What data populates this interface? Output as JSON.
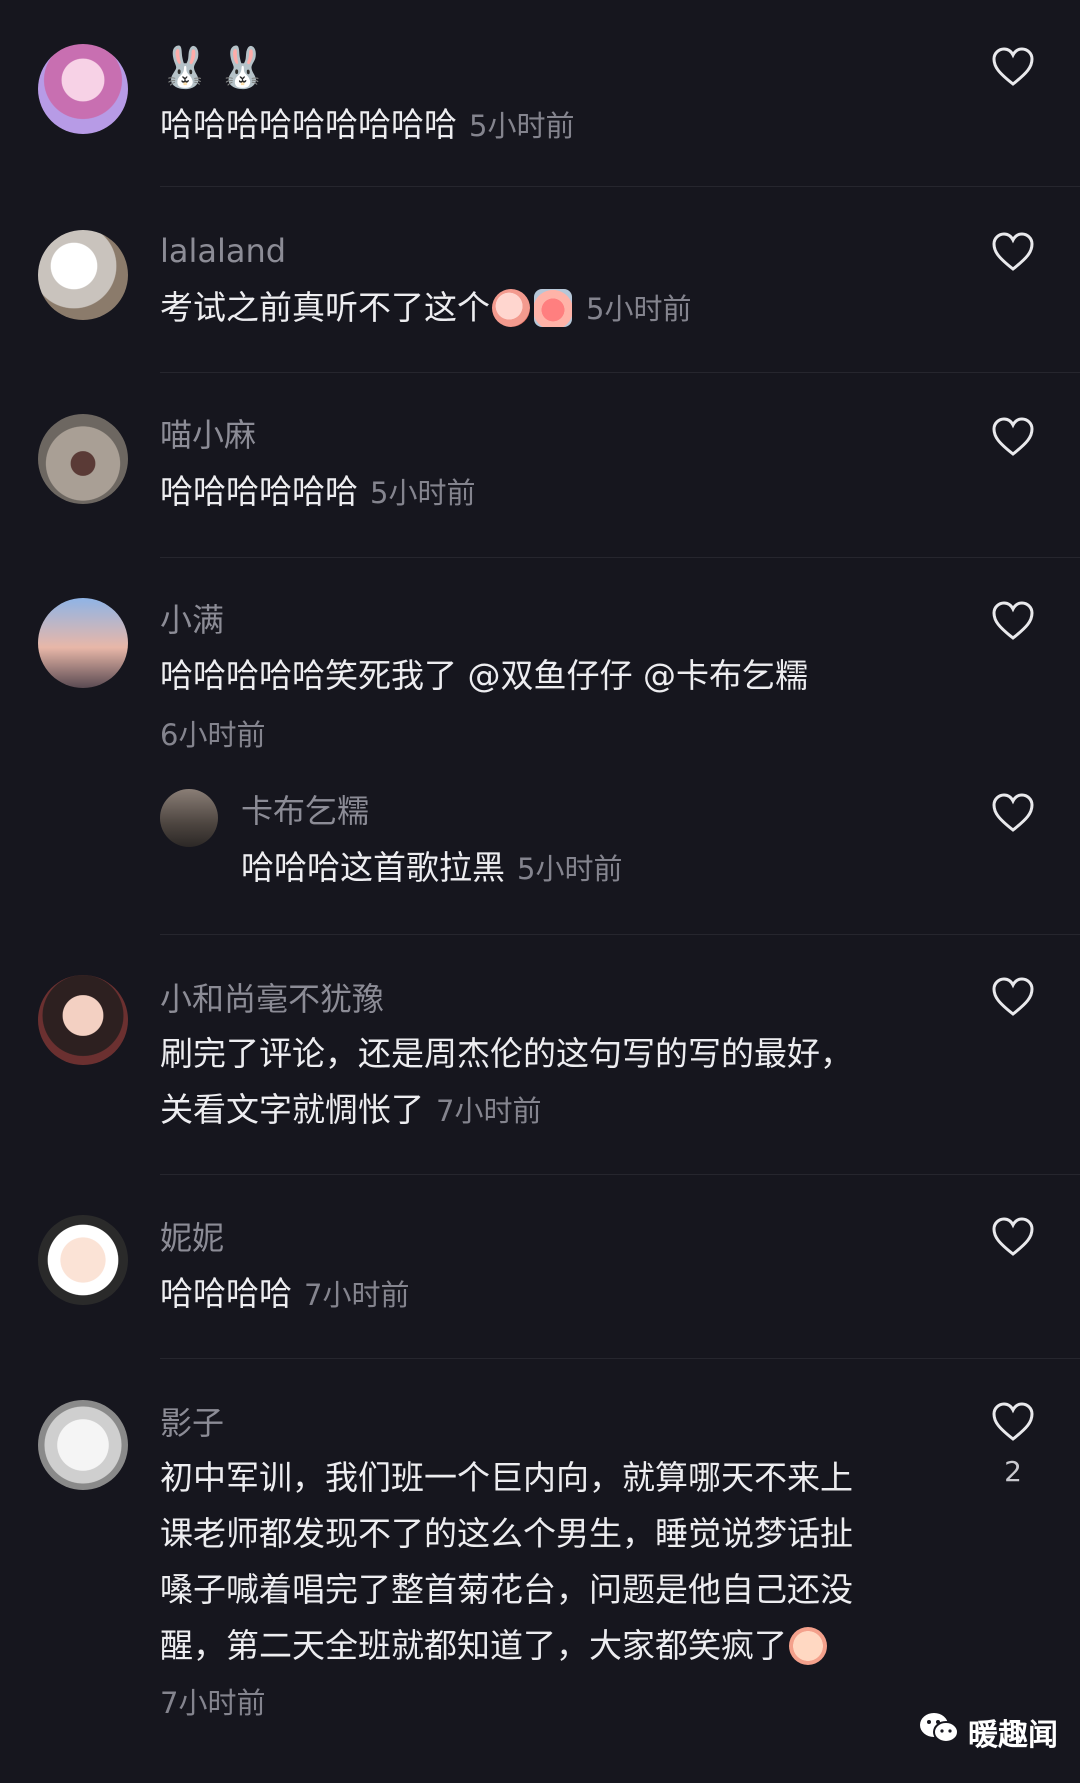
{
  "comments": [
    {
      "name": "",
      "title_emoji": "🐰🐰",
      "text": "哈哈哈哈哈哈哈哈哈",
      "time": "5小时前"
    },
    {
      "name": "lalaland",
      "text": "考试之前真听不了这个",
      "time": "5小时前"
    },
    {
      "name": "喵小麻",
      "text": "哈哈哈哈哈哈",
      "time": "5小时前"
    },
    {
      "name": "小满",
      "text": "哈哈哈哈哈笑死我了 @双鱼仔仔 @卡布乞糯",
      "time": "6小时前"
    },
    {
      "name": "卡布乞糯",
      "text": "哈哈哈这首歌拉黑",
      "time": "5小时前"
    },
    {
      "name": "小和尚毫不犹豫",
      "text_line1": "刷完了评论，还是周杰伦的这句写的写的最好，",
      "text_line2": "关看文字就惆怅了",
      "time": "7小时前"
    },
    {
      "name": "妮妮",
      "text": "哈哈哈哈",
      "time": "7小时前"
    },
    {
      "name": "影子",
      "text_line1": "初中军训，我们班一个巨内向，就算哪天不来上",
      "text_line2": "课老师都发现不了的这么个男生，睡觉说梦话扯",
      "text_line3": "嗓子喊着唱完了整首菊花台，问题是他自己还没",
      "text_line4": "醒，第二天全班就都知道了，大家都笑疯了",
      "time": "7小时前",
      "likes": "2"
    }
  ],
  "watermark": {
    "text": "暖趣闻"
  },
  "colors": {
    "background": "#16161e",
    "name": "#8c8c96",
    "text": "#ededf0",
    "time": "#84848e"
  }
}
